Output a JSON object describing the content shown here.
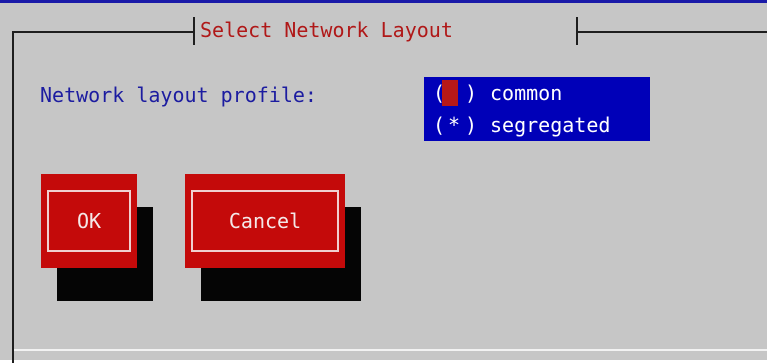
{
  "dialog": {
    "title": "Select Network Layout"
  },
  "form": {
    "label": "Network layout profile:",
    "options": [
      {
        "label": "common",
        "mark": ""
      },
      {
        "label": "segregated",
        "mark": "*"
      }
    ],
    "selected": "segregated",
    "focused": "common"
  },
  "buttons": {
    "ok_label": "OK",
    "cancel_label": "Cancel"
  },
  "colors": {
    "background": "#c6c6c6",
    "title_text": "#b01818",
    "label_text": "#1c1ca0",
    "list_highlight": "#0000b8",
    "button": "#c40a0a",
    "shadow": "#050505"
  }
}
